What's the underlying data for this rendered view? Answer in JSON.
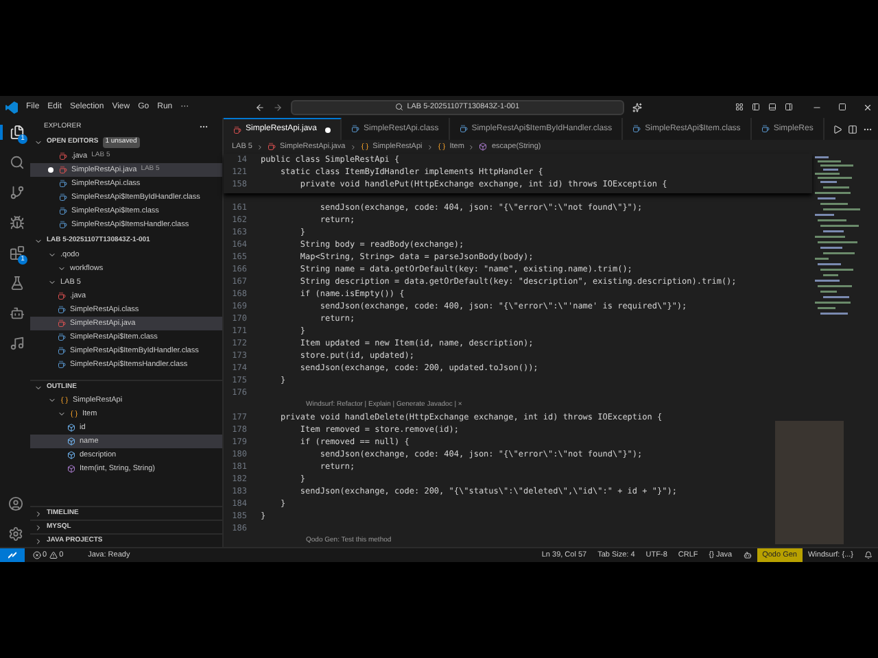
{
  "menu": [
    "File",
    "Edit",
    "Selection",
    "View",
    "Go",
    "Run",
    "···"
  ],
  "command_center": {
    "text": "LAB 5-20251107T130843Z-1-001"
  },
  "activity_bar": [
    {
      "kind": "files",
      "badge": "1",
      "selected": true
    },
    {
      "kind": "search",
      "selected": false
    },
    {
      "kind": "git",
      "selected": false
    },
    {
      "kind": "debug",
      "selected": false
    },
    {
      "kind": "extensions",
      "badge": "1",
      "selected": false
    },
    {
      "kind": "flask",
      "selected": false
    },
    {
      "kind": "robot",
      "selected": false
    },
    {
      "kind": "music",
      "selected": false
    }
  ],
  "explorer": {
    "title": "EXPLORER",
    "open_editors": {
      "title": "OPEN EDITORS",
      "badge": "1 unsaved",
      "items": [
        {
          "name": ".java",
          "hint": "LAB 5",
          "kind": "java",
          "modified": false,
          "selected": false
        },
        {
          "name": "SimpleRestApi.java",
          "hint": "LAB 5",
          "kind": "java",
          "modified": true,
          "selected": true
        },
        {
          "name": "SimpleRestApi.class",
          "kind": "class",
          "modified": false,
          "selected": false
        },
        {
          "name": "SimpleRestApi$ItemByIdHandler.class",
          "kind": "class",
          "modified": false,
          "selected": false
        },
        {
          "name": "SimpleRestApi$Item.class",
          "kind": "class",
          "modified": false,
          "selected": false
        },
        {
          "name": "SimpleRestApi$ItemsHandler.class",
          "kind": "class",
          "modified": false,
          "selected": false
        }
      ]
    },
    "folder": {
      "title": "LAB 5-20251107T130843Z-1-001",
      "children": [
        {
          "name": ".qodo",
          "kind": "folder",
          "expanded": true,
          "selected": false,
          "children": [
            {
              "name": "workflows",
              "kind": "folder",
              "expanded": true,
              "selected": false
            }
          ]
        },
        {
          "name": "LAB 5",
          "kind": "folder",
          "expanded": true,
          "selected": false,
          "children": [
            {
              "name": ".java",
              "kind": "java",
              "selected": false
            },
            {
              "name": "SimpleRestApi.class",
              "kind": "class",
              "selected": false
            },
            {
              "name": "SimpleRestApi.java",
              "kind": "java",
              "selected": true
            },
            {
              "name": "SimpleRestApi$Item.class",
              "kind": "class",
              "selected": false
            },
            {
              "name": "SimpleRestApi$ItemByIdHandler.class",
              "kind": "class",
              "selected": false
            },
            {
              "name": "SimpleRestApi$ItemsHandler.class",
              "kind": "class",
              "selected": false
            }
          ]
        }
      ]
    },
    "outline": {
      "title": "OUTLINE",
      "children": [
        {
          "name": "SimpleRestApi",
          "kind": "class",
          "expanded": true,
          "selected": false,
          "children": [
            {
              "name": "Item",
              "kind": "class",
              "expanded": true,
              "selected": false,
              "children": [
                {
                  "name": "id",
                  "kind": "field",
                  "selected": false
                },
                {
                  "name": "name",
                  "kind": "field",
                  "selected": true
                },
                {
                  "name": "description",
                  "kind": "field",
                  "selected": false
                },
                {
                  "name": "Item(int, String, String)",
                  "kind": "method",
                  "selected": false
                }
              ]
            }
          ]
        }
      ]
    },
    "collapsed_sections": [
      "TIMELINE",
      "MYSQL",
      "JAVA PROJECTS"
    ]
  },
  "tabs": [
    {
      "label": "SimpleRestApi.java",
      "modified": true,
      "selected": true
    },
    {
      "label": "SimpleRestApi.class",
      "modified": false,
      "selected": false
    },
    {
      "label": "SimpleRestApi$ItemByIdHandler.class",
      "modified": false,
      "selected": false
    },
    {
      "label": "SimpleRestApi$Item.class",
      "modified": false,
      "selected": false
    },
    {
      "label": "SimpleRes",
      "modified": false,
      "selected": false
    }
  ],
  "breadcrumb": [
    {
      "label": "LAB 5",
      "kind": "folder"
    },
    {
      "label": "SimpleRestApi.java",
      "kind": "java"
    },
    {
      "label": "SimpleRestApi",
      "kind": "class"
    },
    {
      "label": "Item",
      "kind": "class"
    },
    {
      "label": "escape(String)",
      "kind": "method"
    }
  ],
  "sticky_lines": [
    {
      "number": "14",
      "text": "public class SimpleRestApi {"
    },
    {
      "number": "121",
      "text": "    static class ItemByIdHandler implements HttpHandler {"
    },
    {
      "number": "158",
      "text": "        private void handlePut(HttpExchange exchange, int id) throws IOException {"
    }
  ],
  "code_lines": [
    {
      "kind": "code",
      "number": "161",
      "text": "            sendJson(exchange, code: 404, json: \"{\\\"error\\\":\\\"not found\\\"}\");"
    },
    {
      "kind": "code",
      "number": "162",
      "text": "            return;"
    },
    {
      "kind": "code",
      "number": "163",
      "text": "        }"
    },
    {
      "kind": "code",
      "number": "164",
      "text": "        String body = readBody(exchange);"
    },
    {
      "kind": "code",
      "number": "165",
      "text": "        Map<String, String> data = parseJsonBody(body);"
    },
    {
      "kind": "code",
      "number": "166",
      "text": "        String name = data.getOrDefault(key: \"name\", existing.name).trim();"
    },
    {
      "kind": "code",
      "number": "167",
      "text": "        String description = data.getOrDefault(key: \"description\", existing.description).trim();"
    },
    {
      "kind": "code",
      "number": "168",
      "text": "        if (name.isEmpty()) {"
    },
    {
      "kind": "code",
      "number": "169",
      "text": "            sendJson(exchange, code: 400, json: \"{\\\"error\\\":\\\"'name' is required\\\"}\");"
    },
    {
      "kind": "code",
      "number": "170",
      "text": "            return;"
    },
    {
      "kind": "code",
      "number": "171",
      "text": "        }"
    },
    {
      "kind": "code",
      "number": "172",
      "text": "        Item updated = new Item(id, name, description);"
    },
    {
      "kind": "code",
      "number": "173",
      "text": "        store.put(id, updated);"
    },
    {
      "kind": "code",
      "number": "174",
      "text": "        sendJson(exchange, code: 200, updated.toJson());"
    },
    {
      "kind": "code",
      "number": "175",
      "text": "    }"
    },
    {
      "kind": "code",
      "number": "176"
    },
    {
      "kind": "lens",
      "text": "Windsurf: Refactor | Explain | Generate Javadoc | ×"
    },
    {
      "kind": "code",
      "number": "177",
      "text": "    private void handleDelete(HttpExchange exchange, int id) throws IOException {"
    },
    {
      "kind": "code",
      "number": "178",
      "text": "        Item removed = store.remove(id);"
    },
    {
      "kind": "code",
      "number": "179",
      "text": "        if (removed == null) {"
    },
    {
      "kind": "code",
      "number": "180",
      "text": "            sendJson(exchange, code: 404, json: \"{\\\"error\\\":\\\"not found\\\"}\");"
    },
    {
      "kind": "code",
      "number": "181",
      "text": "            return;"
    },
    {
      "kind": "code",
      "number": "182",
      "text": "        }"
    },
    {
      "kind": "code",
      "number": "183",
      "text": "        sendJson(exchange, code: 200, \"{\\\"status\\\":\\\"deleted\\\",\\\"id\\\":\" + id + \"}\");"
    },
    {
      "kind": "code",
      "number": "184",
      "text": "    }"
    },
    {
      "kind": "code",
      "number": "185",
      "text": "}"
    },
    {
      "kind": "code",
      "number": "186"
    },
    {
      "kind": "lens",
      "text": "Qodo Gen: Test this method"
    }
  ],
  "status_bar": {
    "errors": "0",
    "warnings": "0",
    "left": [
      "Java: Ready"
    ],
    "right": [
      {
        "text": "Ln 39, Col 57",
        "highlighted": false
      },
      {
        "text": "Tab Size: 4",
        "highlighted": false
      },
      {
        "text": "UTF-8",
        "highlighted": false
      },
      {
        "text": "CRLF",
        "highlighted": false
      },
      {
        "text": "{} Java",
        "highlighted": false
      },
      {
        "text": "Qodo Gen",
        "highlighted": true
      },
      {
        "text": "Windsurf: {...}",
        "highlighted": false
      }
    ]
  }
}
